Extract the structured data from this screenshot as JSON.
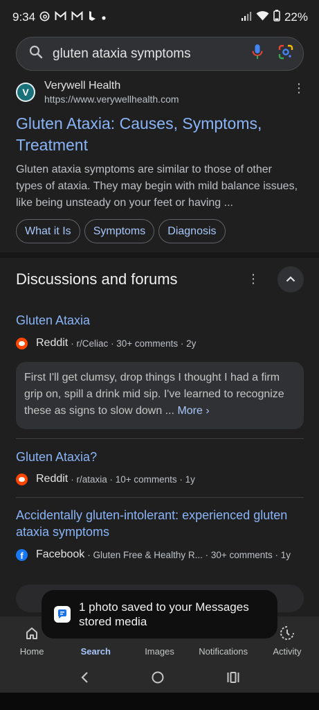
{
  "status_bar": {
    "time": "9:34",
    "notification_icons": [
      "threads-icon",
      "gmail-icon",
      "gmail-icon",
      "bing-icon",
      "dot-icon"
    ],
    "battery": "22%"
  },
  "search": {
    "query": "gluten ataxia symptoms"
  },
  "result": {
    "site_name": "Verywell Health",
    "site_url": "https://www.verywellhealth.com",
    "title": "Gluten Ataxia: Causes, Symptoms, Treatment",
    "snippet": "Gluten ataxia symptoms are similar to those of other types of ataxia. They may begin with mild balance issues, like being unsteady on your feet or having ...",
    "chips": [
      "What it Is",
      "Symptoms",
      "Diagnosis"
    ]
  },
  "discussions": {
    "heading": "Discussions and forums",
    "threads": [
      {
        "title": "Gluten Ataxia",
        "source": "Reddit",
        "meta": "· r/Celiac · 30+ comments · 2y",
        "quote": "First I'll get clumsy, drop things I thought I had a firm grip on, spill a drink mid sip. I've learned to recognize these as signs to slow down ...",
        "more": "More ›"
      },
      {
        "title": "Gluten Ataxia?",
        "source": "Reddit",
        "meta": "· r/ataxia · 10+ comments · 1y"
      },
      {
        "title": "Accidentally gluten-intolerant: experienced gluten ataxia symptoms",
        "source": "Facebook",
        "meta": "· Gluten Free & Healthy R... · 30+ comments · 1y"
      }
    ]
  },
  "toast": {
    "message": "1 photo saved to your Messages stored media"
  },
  "bottom_nav": {
    "items": [
      "Home",
      "Search",
      "Images",
      "Notifications",
      "Activity"
    ],
    "active": "Search"
  },
  "colors": {
    "link": "#8ab4f8",
    "background": "#1f1f1f",
    "chip_text": "#a8c7fa"
  }
}
